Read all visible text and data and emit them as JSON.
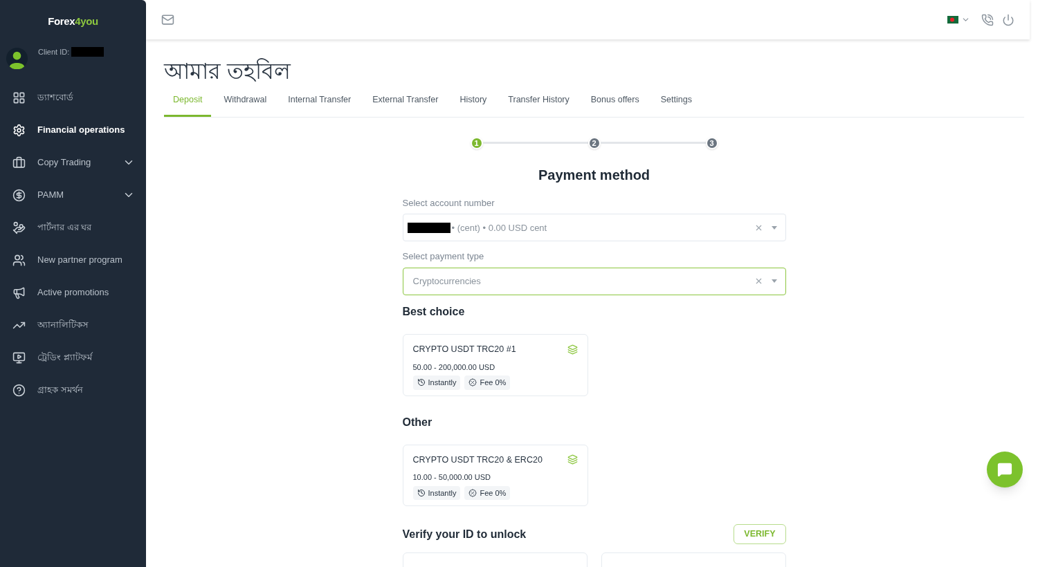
{
  "logo": {
    "text_start": "Forex",
    "text_end": "4you"
  },
  "client": {
    "label": "Client ID:"
  },
  "sidebar": {
    "items": [
      {
        "label": "ড্যাশবোর্ড",
        "kind": "link",
        "selected": false
      },
      {
        "label": "Financial operations",
        "kind": "link",
        "selected": true
      },
      {
        "label": "Copy Trading",
        "kind": "group",
        "selected": false,
        "expanded": false
      },
      {
        "label": "PAMM",
        "kind": "group",
        "selected": false,
        "expanded": false
      },
      {
        "label": "পার্টনার এর ঘর",
        "kind": "link",
        "selected": false
      },
      {
        "label": "New partner program",
        "kind": "link",
        "selected": false
      },
      {
        "label": "Active promotions",
        "kind": "link",
        "selected": false
      },
      {
        "label": "অ্যানালিটিকস",
        "kind": "link",
        "selected": false
      },
      {
        "label": "ট্রেডিং প্ল্যাটফর্ম",
        "kind": "link",
        "selected": false
      },
      {
        "label": "গ্রাহক সমর্থন",
        "kind": "link",
        "selected": false
      }
    ]
  },
  "page": {
    "title": "আমার তহবিল"
  },
  "tabs": [
    {
      "label": "Deposit",
      "selected": true
    },
    {
      "label": "Withdrawal",
      "selected": false
    },
    {
      "label": "Internal Transfer",
      "selected": false
    },
    {
      "label": "External Transfer",
      "selected": false
    },
    {
      "label": "History",
      "selected": false
    },
    {
      "label": "Transfer History",
      "selected": false
    },
    {
      "label": "Bonus offers",
      "selected": false
    },
    {
      "label": "Settings",
      "selected": false
    }
  ],
  "steps": [
    {
      "label": "1",
      "selected": true
    },
    {
      "label": "2",
      "selected": false
    },
    {
      "label": "3",
      "selected": false
    }
  ],
  "form": {
    "title": "Payment method",
    "account": {
      "label": "Select account number",
      "value": "• (cent) • 0.00 USD cent"
    },
    "payment_type": {
      "label": "Select payment type",
      "value": "Cryptocurrencies"
    }
  },
  "sections": [
    {
      "title": "Best choice",
      "cards": [
        {
          "title": "CRYPTO USDT TRC20 #1",
          "range": "50.00 - 200,000.00 USD",
          "tags": [
            "Instantly",
            "Fee 0%"
          ]
        }
      ]
    },
    {
      "title": "Other",
      "cards": [
        {
          "title": "CRYPTO USDT TRC20 & ERC20",
          "range": "10.00 - 50,000.00 USD",
          "tags": [
            "Instantly",
            "Fee 0%"
          ]
        }
      ]
    }
  ],
  "verify": {
    "title": "Verify your ID to unlock",
    "button": "VERIFY"
  }
}
